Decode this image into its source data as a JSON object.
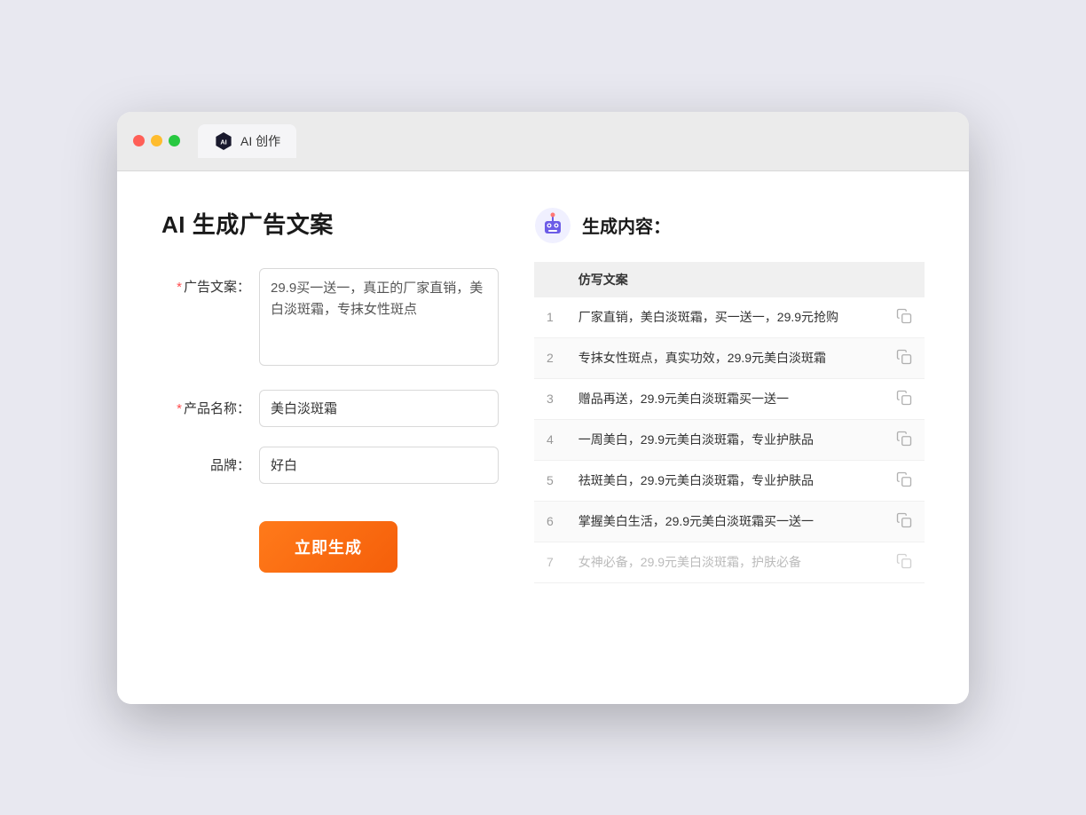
{
  "window": {
    "tab_label": "AI 创作"
  },
  "left_panel": {
    "title": "AI 生成广告文案",
    "ad_copy_label": "广告文案：",
    "ad_copy_required": "*",
    "ad_copy_value": "29.9买一送一，真正的厂家直销，美白淡斑霜，专抹女性斑点",
    "product_name_label": "产品名称：",
    "product_name_required": "*",
    "product_name_value": "美白淡斑霜",
    "brand_label": "品牌：",
    "brand_value": "好白",
    "generate_button": "立即生成"
  },
  "right_panel": {
    "title": "生成内容：",
    "column_header": "仿写文案",
    "results": [
      {
        "id": 1,
        "text": "厂家直销，美白淡斑霜，买一送一，29.9元抢购"
      },
      {
        "id": 2,
        "text": "专抹女性斑点，真实功效，29.9元美白淡斑霜"
      },
      {
        "id": 3,
        "text": "赠品再送，29.9元美白淡斑霜买一送一"
      },
      {
        "id": 4,
        "text": "一周美白，29.9元美白淡斑霜，专业护肤品"
      },
      {
        "id": 5,
        "text": "祛斑美白，29.9元美白淡斑霜，专业护肤品"
      },
      {
        "id": 6,
        "text": "掌握美白生活，29.9元美白淡斑霜买一送一"
      },
      {
        "id": 7,
        "text": "女神必备，29.9元美白淡斑霜，护肤必备",
        "faded": true
      }
    ]
  }
}
